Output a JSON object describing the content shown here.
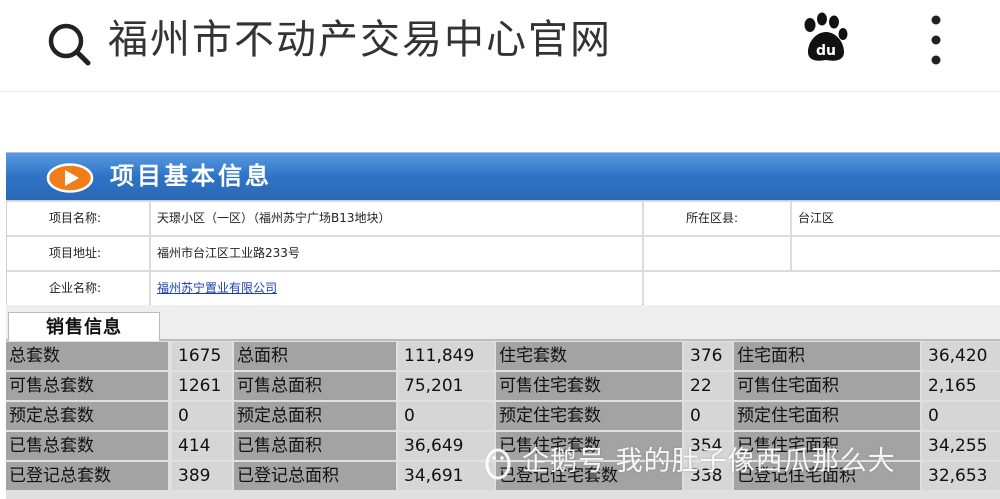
{
  "search": {
    "query": "福州市不动产交易中心官网"
  },
  "section": {
    "title": "项目基本信息"
  },
  "info": {
    "project_name_label": "项目名称:",
    "project_name_value": "天璟小区（一区）（福州苏宁广场B13地块）",
    "district_label": "所在区县:",
    "district_value": "台江区",
    "address_label": "项目地址:",
    "address_value": "福州市台江区工业路233号",
    "company_label": "企业名称:",
    "company_value": "福州苏宁置业有限公司"
  },
  "tab": {
    "label": "销售信息"
  },
  "sales": {
    "rows": [
      [
        "总套数",
        "1675",
        "总面积",
        "111,849",
        "住宅套数",
        "376",
        "住宅面积",
        "36,420"
      ],
      [
        "可售总套数",
        "1261",
        "可售总面积",
        "75,201",
        "可售住宅套数",
        "22",
        "可售住宅面积",
        "2,165"
      ],
      [
        "预定总套数",
        "0",
        "预定总面积",
        "0",
        "预定住宅套数",
        "0",
        "预定住宅面积",
        "0"
      ],
      [
        "已售总套数",
        "414",
        "已售总面积",
        "36,649",
        "已售住宅套数",
        "354",
        "已售住宅面积",
        "34,255"
      ],
      [
        "已登记总套数",
        "389",
        "已登记总面积",
        "34,691",
        "已登记住宅套数",
        "338",
        "已登记住宅面积",
        "32,653"
      ]
    ]
  },
  "watermark": {
    "text": "企鹅号 我的肚子像西瓜那么大"
  },
  "icons": {
    "search": "search-icon",
    "baidu": "baidu-paw-icon",
    "more": "more-vertical-icon",
    "play": "play-circle-icon"
  },
  "colors": {
    "header_blue": "#2f73c6",
    "label_gray": "#a3a3a3",
    "value_gray": "#d6d6d6",
    "link": "#1a3fa8"
  }
}
